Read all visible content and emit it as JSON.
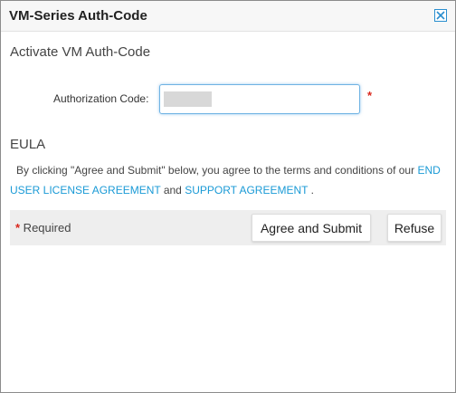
{
  "dialog": {
    "title": "VM-Series Auth-Code",
    "close_icon": "close-x-icon",
    "close_color": "#2a8ecf"
  },
  "activate": {
    "heading": "Activate VM Auth-Code",
    "auth_label": "Authorization Code:",
    "auth_value": "",
    "auth_value_obscured": true,
    "required_marker": "*"
  },
  "eula": {
    "heading": "EULA",
    "text_before": "By clicking \"Agree and Submit\" below, you agree to the terms and conditions of our ",
    "link_eula": "END USER LICENSE AGREEMENT",
    "text_middle": " and ",
    "link_support": "SUPPORT AGREEMENT",
    "text_after": " ."
  },
  "footer": {
    "required_star": "*",
    "required_text": " Required",
    "submit_label": "Agree and Submit",
    "refuse_label": "Refuse"
  },
  "colors": {
    "link": "#1a9ad6",
    "required": "#d9261c",
    "footer_bg": "#eeeeee"
  }
}
